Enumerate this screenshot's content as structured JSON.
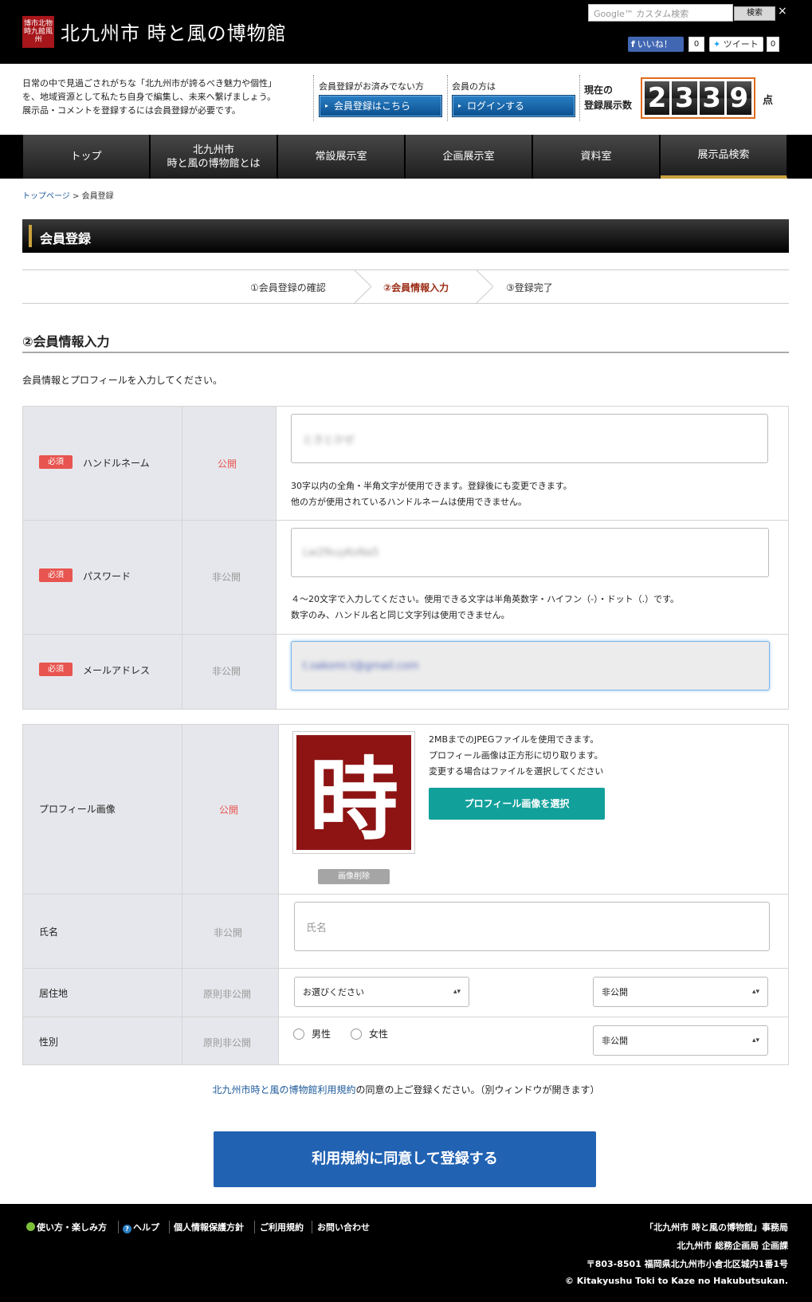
{
  "header": {
    "logo_seal_text": "博市北物時九館風州",
    "site_title": "北九州市 時と風の博物館",
    "search_placeholder": "Google™ カスタム検索",
    "search_button": "検索",
    "close": "×",
    "fb_like": "いいね！",
    "fb_count": "0",
    "tweet": "ツイート",
    "tweet_count": "0"
  },
  "info": {
    "intro_line1": "日常の中で見過ごされがちな「北九州市が誇るべき魅力や個性」",
    "intro_line2": "を、地域資源として私たち自身で編集し、未来へ繋げましょう。",
    "intro_line3": "展示品・コメントを登録するには会員登録が必要です。",
    "not_member_label": "会員登録がお済みでない方",
    "register_button": "会員登録はこちら",
    "member_label": "会員の方は",
    "login_button": "ログインする",
    "count_label_line1": "現在の",
    "count_label_line2": "登録展示数",
    "count_digits": [
      "2",
      "3",
      "3",
      "9"
    ],
    "count_unit": "点"
  },
  "nav": {
    "items": [
      {
        "label": "トップ"
      },
      {
        "label_line1": "北九州市",
        "label_line2": "時と風の博物館とは"
      },
      {
        "label": "常設展示室"
      },
      {
        "label": "企画展示室"
      },
      {
        "label": "資料室"
      },
      {
        "label": "展示品検索"
      }
    ]
  },
  "breadcrumb": {
    "home": "トップページ",
    "sep": ">",
    "current": "会員登録"
  },
  "page_title": "会員登録",
  "steps": [
    "①会員登録の確認",
    "②会員情報入力",
    "③登録完了"
  ],
  "form": {
    "heading": "②会員情報入力",
    "description": "会員情報とプロフィールを入力してください。",
    "required_badge": "必須",
    "public": "公開",
    "private": "非公開",
    "principal_private": "原則非公開",
    "handle": {
      "label": "ハンドルネーム",
      "value": "ときとかぜ",
      "hint1": "30字以内の全角・半角文字が使用できます。登録後にも変更できます。",
      "hint2": "他の方が使用されているハンドルネームは使用できません。"
    },
    "password": {
      "label": "パスワード",
      "value": "Lw2fkuyKoNa5",
      "hint1": "４～20文字で入力してください。使用できる文字は半角英数字・ハイフン（-）・ドット（.）です。",
      "hint2": "数字のみ、ハンドル名と同じ文字列は使用できません。"
    },
    "email": {
      "label": "メールアドレス",
      "value": "t.sakomi.t@gmail.com"
    },
    "profile_image": {
      "label": "プロフィール画像",
      "seal_char": "時",
      "delete_button": "画像削除",
      "hint1": "2MBまでのJPEGファイルを使用できます。",
      "hint2": "プロフィール画像は正方形に切り取ります。",
      "hint3": "変更する場合はファイルを選択してください",
      "select_button": "プロフィール画像を選択"
    },
    "name": {
      "label": "氏名",
      "placeholder": "氏名"
    },
    "residence": {
      "label": "居住地",
      "select_value": "お選びください",
      "visibility_value": "非公開"
    },
    "gender": {
      "label": "性別",
      "option_male": "男性",
      "option_female": "女性",
      "visibility_value": "非公開"
    }
  },
  "terms": {
    "link": "北九州市時と風の博物館利用規約",
    "text": "の同意の上ご登録ください。（別ウィンドウが開きます）"
  },
  "submit_button": "利用規約に同意して登録する",
  "footer": {
    "links": [
      "使い方・楽しみ方",
      "ヘルプ",
      "個人情報保護方針",
      "ご利用規約",
      "お問い合わせ"
    ],
    "office": "「北九州市 時と風の博物館」事務局",
    "dept": "北九州市 総務企画局 企画課",
    "address": "〒803-8501 福岡県北九州市小倉北区城内1番1号",
    "copyright": "© Kitakyushu Toki to Kaze no Hakubutsukan."
  },
  "colors": {
    "accent_gold": "#c9a23e",
    "required_red": "#e8544f",
    "submit_blue": "#2162b3",
    "teal": "#12a09b",
    "counter_orange": "#e06a1a"
  }
}
